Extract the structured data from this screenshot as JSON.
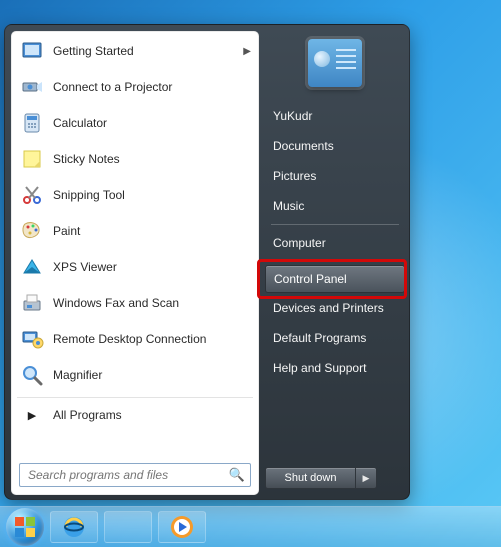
{
  "left_items": [
    {
      "label": "Getting Started",
      "has_sub": true,
      "icon": "getting-started"
    },
    {
      "label": "Connect to a Projector",
      "icon": "projector"
    },
    {
      "label": "Calculator",
      "icon": "calculator"
    },
    {
      "label": "Sticky Notes",
      "icon": "sticky"
    },
    {
      "label": "Snipping Tool",
      "icon": "snip"
    },
    {
      "label": "Paint",
      "icon": "paint"
    },
    {
      "label": "XPS Viewer",
      "icon": "xps"
    },
    {
      "label": "Windows Fax and Scan",
      "icon": "fax"
    },
    {
      "label": "Remote Desktop Connection",
      "icon": "rdp"
    },
    {
      "label": "Magnifier",
      "icon": "magnifier"
    }
  ],
  "all_programs": "All Programs",
  "search_placeholder": "Search programs and files",
  "right_items": [
    {
      "label": "YuKudr"
    },
    {
      "label": "Documents"
    },
    {
      "label": "Pictures"
    },
    {
      "label": "Music"
    },
    {
      "sep": true
    },
    {
      "label": "Computer"
    },
    {
      "sep": true
    },
    {
      "label": "Control Panel",
      "highlighted": true
    },
    {
      "label": "Devices and Printers"
    },
    {
      "label": "Default Programs"
    },
    {
      "label": "Help and Support"
    }
  ],
  "shutdown": "Shut down",
  "taskbar": [
    {
      "name": "start",
      "icon": "orb"
    },
    {
      "name": "ie",
      "icon": "ie"
    },
    {
      "name": "explorer",
      "icon": "folder"
    },
    {
      "name": "wmp",
      "icon": "wmp"
    }
  ]
}
